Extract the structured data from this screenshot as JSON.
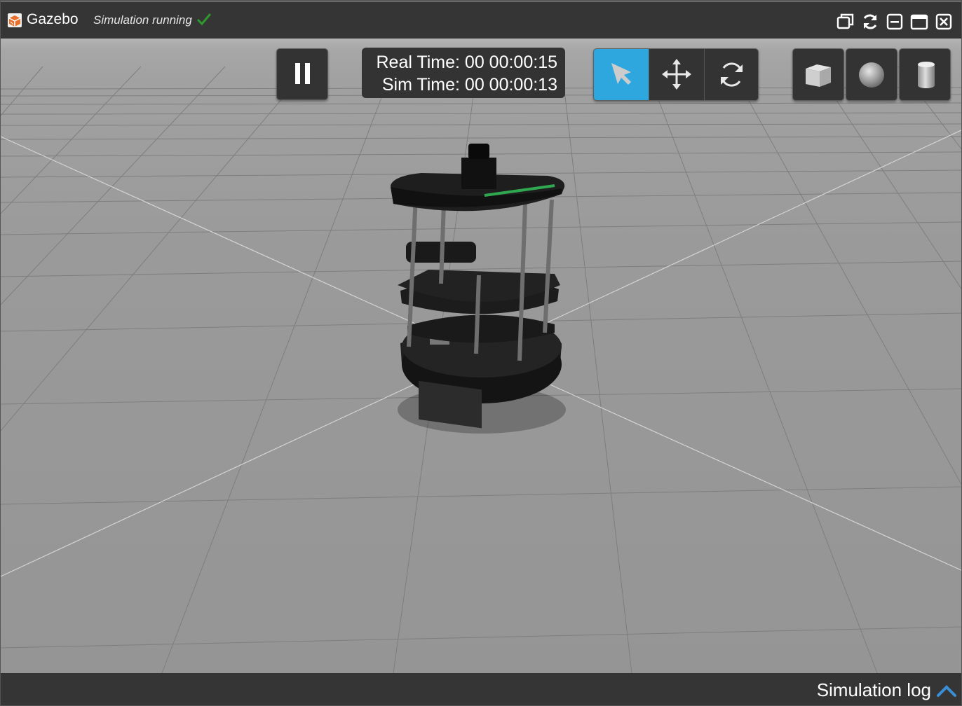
{
  "window": {
    "app_name": "Gazebo",
    "status_text": "Simulation running",
    "controls": [
      "restore-icon",
      "refresh-icon",
      "minimize-icon",
      "maximize-icon",
      "close-icon"
    ]
  },
  "toolbar": {
    "pause_icon": "pause-icon",
    "real_time_label": "Real Time: 00 00:00:15",
    "sim_time_label": "Sim Time: 00 00:00:13",
    "modes": [
      "select-arrow-icon",
      "translate-icon",
      "rotate-icon"
    ],
    "active_mode": "select-arrow-icon",
    "shapes": [
      "box-icon",
      "sphere-icon",
      "cylinder-icon"
    ]
  },
  "footer": {
    "log_label": "Simulation log"
  },
  "colors": {
    "titlebar": "#353535",
    "toolbar": "#333333",
    "active_mode": "#2ea7df",
    "ground": "#9a9a9a",
    "status_check": "#2e9a2e",
    "log_chevron": "#3a8fd6"
  }
}
